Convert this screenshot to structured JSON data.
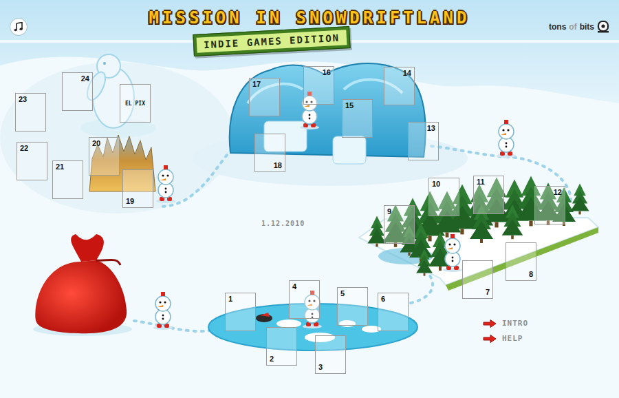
{
  "header": {
    "title": "MISSION IN SNOWDRIFTLAND",
    "subtitle": "INDIE GAMES EDITION",
    "brand": [
      {
        "text": "tons",
        "muted": false
      },
      {
        "text": "of",
        "muted": true
      },
      {
        "text": "bits",
        "muted": false
      }
    ]
  },
  "doors": [
    {
      "number": "1"
    },
    {
      "number": "2"
    },
    {
      "number": "3"
    },
    {
      "number": "4"
    },
    {
      "number": "5"
    },
    {
      "number": "6"
    },
    {
      "number": "7"
    },
    {
      "number": "8"
    },
    {
      "number": "9"
    },
    {
      "number": "10"
    },
    {
      "number": "11"
    },
    {
      "number": "12"
    },
    {
      "number": "13"
    },
    {
      "number": "14"
    },
    {
      "number": "15"
    },
    {
      "number": "16"
    },
    {
      "number": "17"
    },
    {
      "number": "18"
    },
    {
      "number": "19"
    },
    {
      "number": "20"
    },
    {
      "number": "21"
    },
    {
      "number": "22"
    },
    {
      "number": "23"
    },
    {
      "number": "24"
    }
  ],
  "landmark": {
    "label": "EL PIX"
  },
  "date": "1.12.2010",
  "links": [
    {
      "label": "INTRO"
    },
    {
      "label": "HELP"
    }
  ]
}
